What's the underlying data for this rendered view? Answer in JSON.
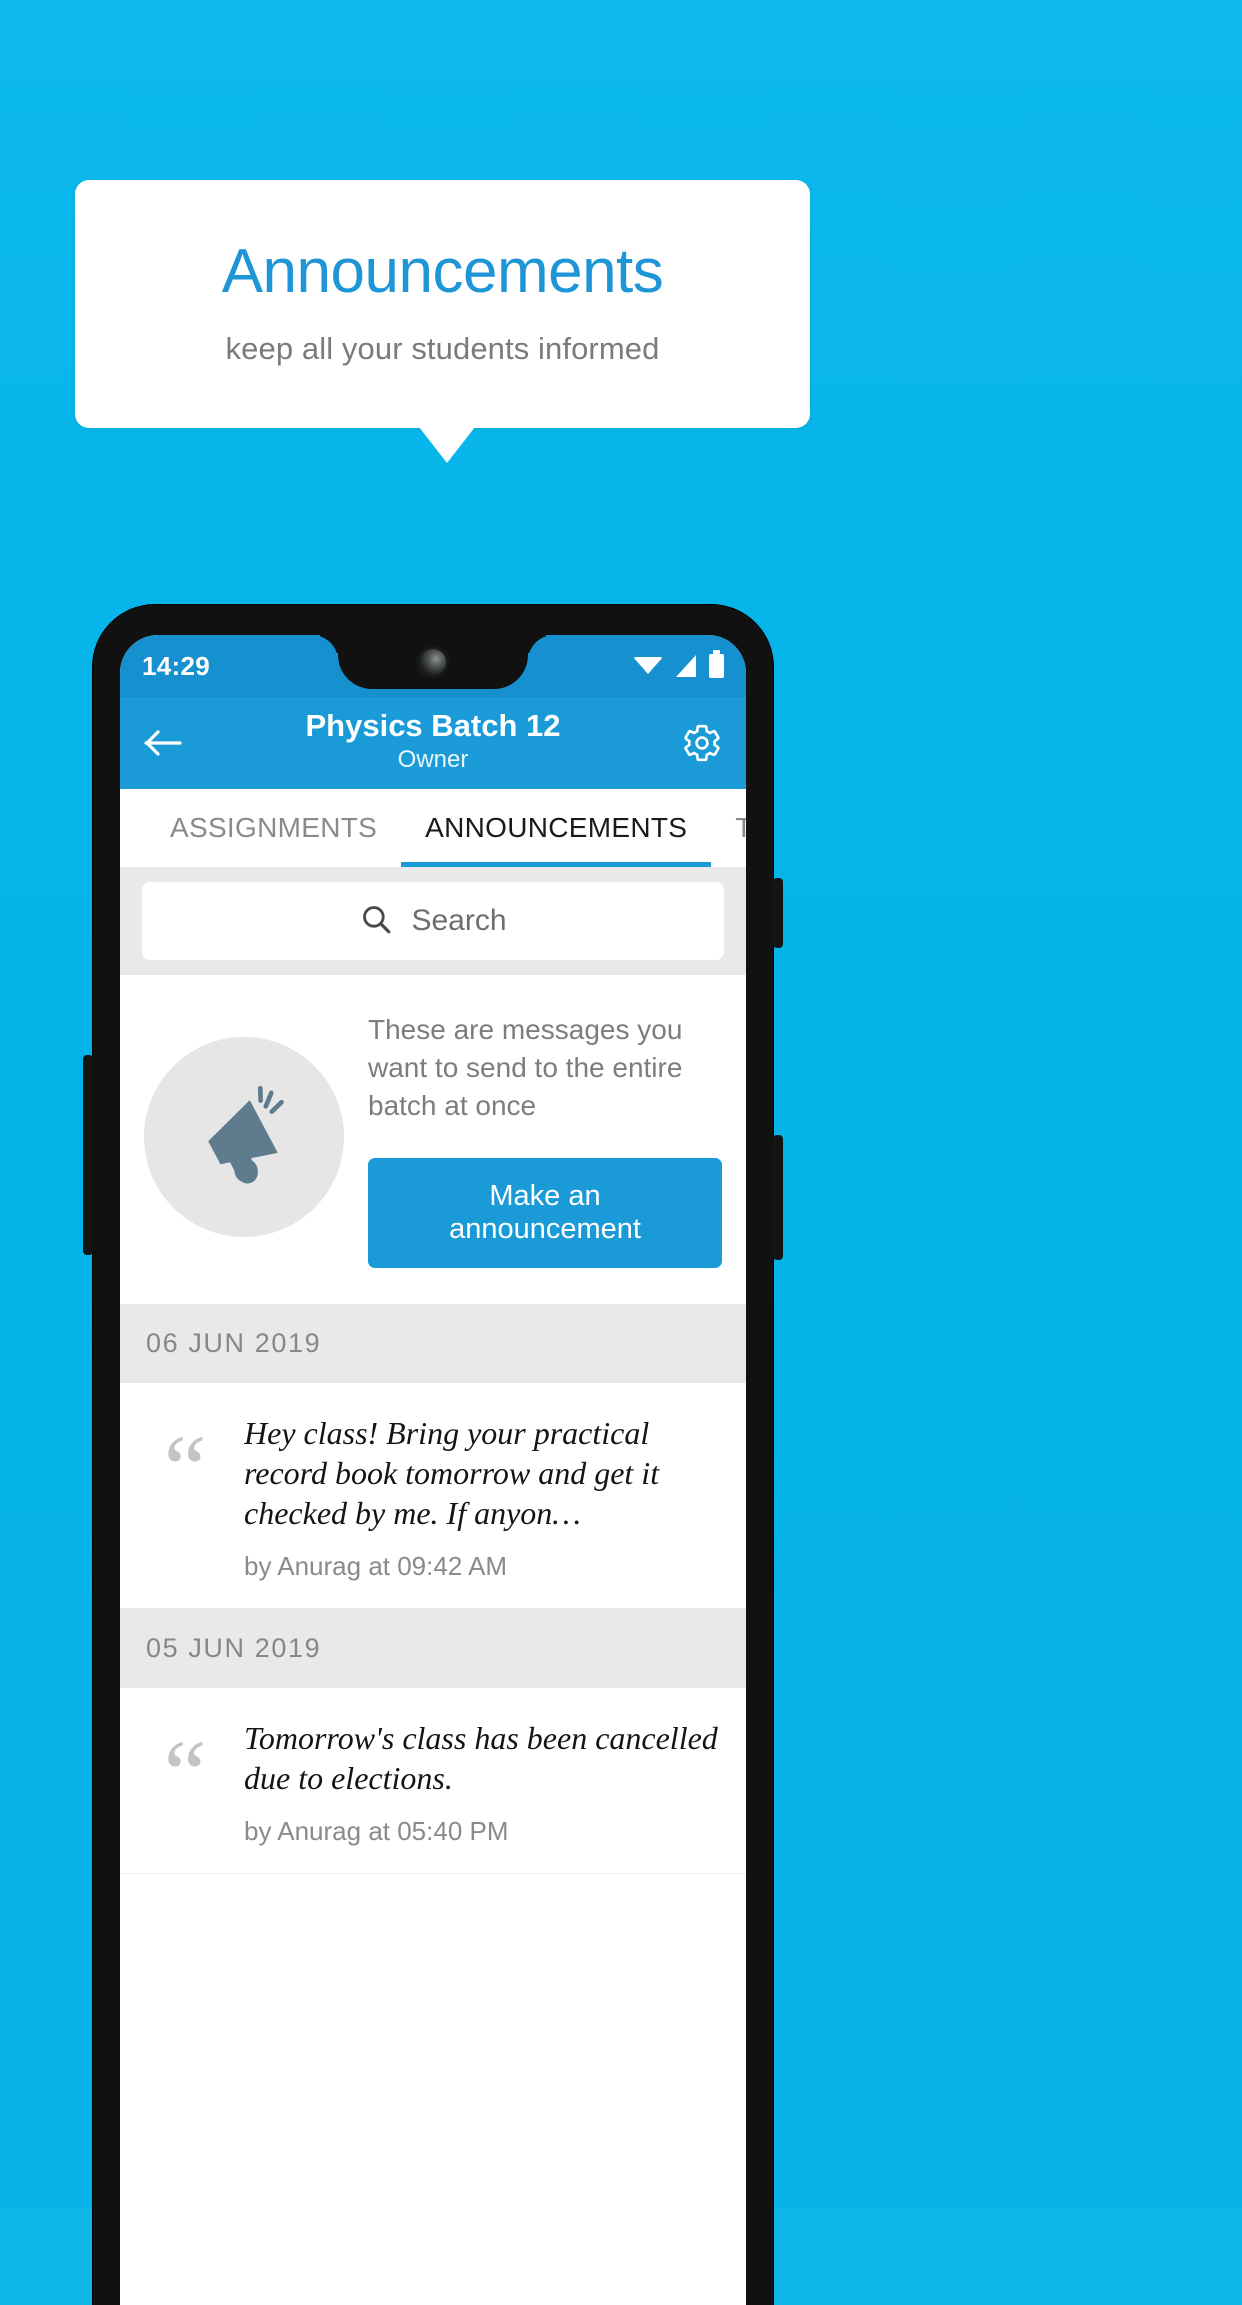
{
  "theme": {
    "background": "#06b2e8",
    "accent": "#1b9ad8",
    "title_blue": "#1e95d6",
    "statusbar_blue": "#1790cf",
    "panel_gray": "#e9e9e9",
    "megaphone_gray": "#5f7b8e"
  },
  "promo": {
    "title": "Announcements",
    "subtitle": "keep all your students informed"
  },
  "phone": {
    "statusbar": {
      "time": "14:29",
      "icons": [
        "wifi-icon",
        "signal-icon",
        "battery-icon"
      ]
    },
    "appbar": {
      "back_icon": "back-arrow-icon",
      "title": "Physics Batch 12",
      "subtitle": "Owner",
      "settings_icon": "gear-icon"
    },
    "tabs": [
      {
        "label": "ASSIGNMENTS",
        "active": false
      },
      {
        "label": "ANNOUNCEMENTS",
        "active": true
      },
      {
        "label": "TESTS",
        "active": false
      },
      {
        "label": "’",
        "active": false
      }
    ],
    "search": {
      "icon": "search-icon",
      "placeholder": "Search",
      "value": ""
    },
    "empty_state": {
      "icon": "megaphone-icon",
      "description": "These are messages you want to send to the entire batch at once",
      "button_label": "Make an announcement"
    },
    "groups": [
      {
        "date": "06 JUN 2019",
        "items": [
          {
            "quote_icon": "quote-icon",
            "text": "Hey class! Bring your practical record book tomorrow and get it checked by me. If anyon…",
            "meta": "by Anurag at 09:42 AM"
          }
        ]
      },
      {
        "date": "05 JUN 2019",
        "items": [
          {
            "quote_icon": "quote-icon",
            "text": "Tomorrow's class has been cancelled due to elections.",
            "meta": "by Anurag at 05:40 PM"
          }
        ]
      }
    ]
  }
}
